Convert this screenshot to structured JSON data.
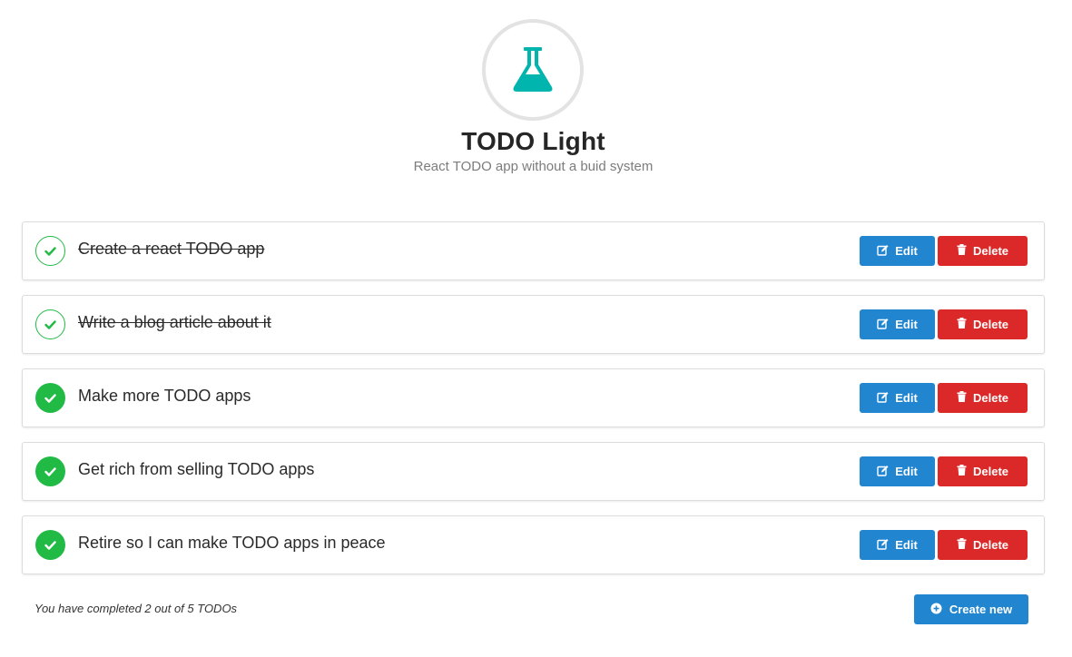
{
  "header": {
    "logo_icon": "flask-icon",
    "logo_color": "#00b5ad",
    "title": "TODO Light",
    "subtitle": "React TODO app without a buid system"
  },
  "todos": [
    {
      "text": "Create a react TODO app",
      "completed": true
    },
    {
      "text": "Write a blog article about it",
      "completed": true
    },
    {
      "text": "Make more TODO apps",
      "completed": false
    },
    {
      "text": "Get rich from selling TODO apps",
      "completed": false
    },
    {
      "text": "Retire so I can make TODO apps in peace",
      "completed": false
    }
  ],
  "actions": {
    "edit_label": "Edit",
    "edit_icon": "edit-icon",
    "delete_label": "Delete",
    "delete_icon": "trash-icon"
  },
  "footer": {
    "status_text": "You have completed 2 out of 5 TODOs",
    "create_label": "Create new",
    "create_icon": "plus-circle-icon"
  },
  "colors": {
    "primary": "#2185d0",
    "danger": "#db2828",
    "success": "#21ba45"
  }
}
